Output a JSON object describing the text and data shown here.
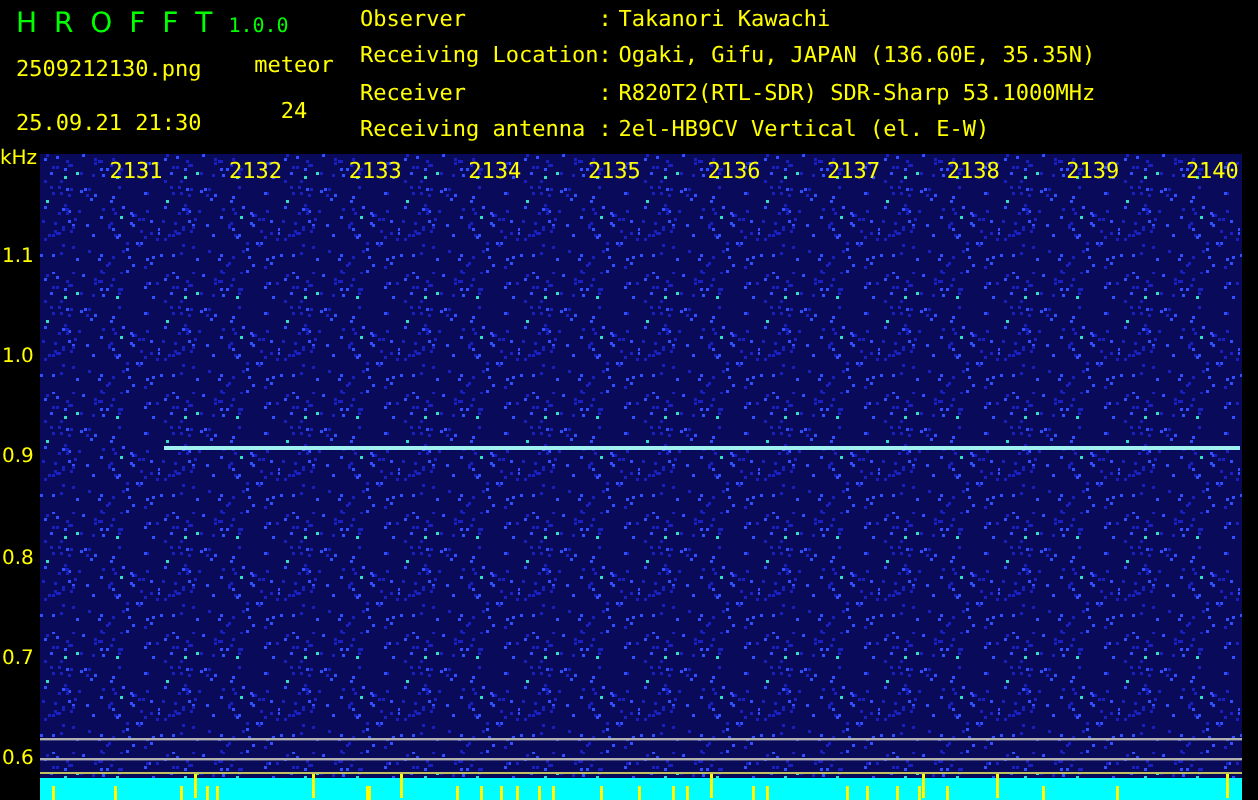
{
  "app": {
    "name": "H R O F F T",
    "version": "1.0.0"
  },
  "file": "2509212130.png",
  "datetime": "25.09.21 21:30",
  "count_label": "meteor",
  "count": "24",
  "info": [
    {
      "label": "Observer",
      "separator": ":",
      "value": "Takanori Kawachi"
    },
    {
      "label": "Receiving Location",
      "separator": ":",
      "value": "Ogaki, Gifu, JAPAN (136.60E, 35.35N)"
    },
    {
      "label": "Receiver",
      "separator": ":",
      "value": "R820T2(RTL-SDR) SDR-Sharp 53.1000MHz"
    },
    {
      "label": "Receiving antenna",
      "separator": ":",
      "value": "2el-HB9CV Vertical (el. E-W)"
    }
  ],
  "spectrogram": {
    "unit": "kHz",
    "x_ticks": [
      "2131",
      "2132",
      "2133",
      "2134",
      "2135",
      "2136",
      "2137",
      "2138",
      "2139",
      "2140"
    ],
    "y_ticks": [
      "1.1",
      "1.0",
      "0.9",
      "0.8",
      "0.7",
      "0.6"
    ]
  }
}
